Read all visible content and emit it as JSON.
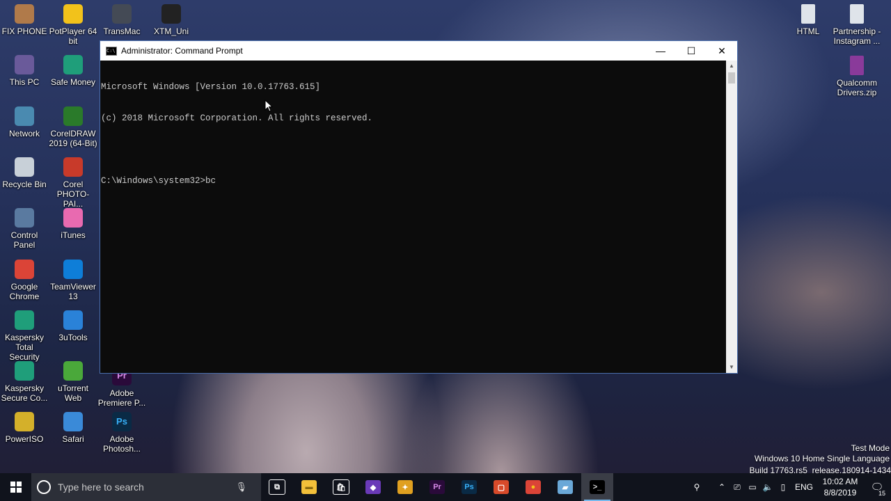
{
  "desktop": {
    "left_column": [
      {
        "label": "FIX PHONE",
        "icon": "phone-icon",
        "color": "#b07a4a"
      },
      {
        "label": "This PC",
        "icon": "computer-icon",
        "color": "#6a5a9a"
      },
      {
        "label": "Network",
        "icon": "network-icon",
        "color": "#4a8ab0"
      },
      {
        "label": "Recycle Bin",
        "icon": "recycle-bin-icon",
        "color": "#c8d0d8"
      },
      {
        "label": "Control Panel",
        "icon": "control-panel-icon",
        "color": "#5a7aa0"
      },
      {
        "label": "Google Chrome",
        "icon": "chrome-icon",
        "color": "#db4437"
      },
      {
        "label": "Kaspersky Total Security",
        "icon": "kaspersky-icon",
        "color": "#1f9e7a"
      },
      {
        "label": "Kaspersky Secure Co...",
        "icon": "kaspersky-secure-icon",
        "color": "#1f9e7a"
      },
      {
        "label": "PowerISO",
        "icon": "poweriso-icon",
        "color": "#d4b02a"
      }
    ],
    "middle_column": [
      {
        "label": "PotPlayer 64 bit",
        "icon": "potplayer-icon",
        "color": "#f2c21b"
      },
      {
        "label": "Safe Money",
        "icon": "safe-money-icon",
        "color": "#1f9e7a"
      },
      {
        "label": "CorelDRAW 2019 (64-Bit)",
        "icon": "coreldraw-icon",
        "color": "#2a7a2a"
      },
      {
        "label": "Corel PHOTO-PAI...",
        "icon": "corel-photopaint-icon",
        "color": "#c83a2a"
      },
      {
        "label": "iTunes",
        "icon": "itunes-icon",
        "color": "#e86ab0"
      },
      {
        "label": "TeamViewer 13",
        "icon": "teamviewer-icon",
        "color": "#0e7ed8"
      },
      {
        "label": "3uTools",
        "icon": "3utools-icon",
        "color": "#2a82d8"
      },
      {
        "label": "uTorrent Web",
        "icon": "utorrent-icon",
        "color": "#4aa83a"
      },
      {
        "label": "Safari",
        "icon": "safari-icon",
        "color": "#3a8ad8"
      }
    ],
    "third_column": [
      {
        "label": "TransMac",
        "icon": "transmac-icon",
        "color": "#444a55"
      },
      {
        "label": "Adobe Premiere P...",
        "icon": "premiere-icon",
        "color": "#2a0a3a"
      },
      {
        "label": "Adobe Photosh...",
        "icon": "photoshop-icon",
        "color": "#0a2a45"
      }
    ],
    "fourth_column": [
      {
        "label": "XTM_Uni",
        "icon": "xtm-icon",
        "color": "#222"
      }
    ],
    "right_column": [
      {
        "label": "HTML",
        "icon": "html-file-icon",
        "color": "#dfe4ea"
      },
      {
        "label": "Partnership - Instagram ...",
        "icon": "document-icon",
        "color": "#dfe4ea"
      },
      {
        "label": "Qualcomm Drivers.zip",
        "icon": "zip-archive-icon",
        "color": "#8a3a9a"
      }
    ]
  },
  "cmd_window": {
    "title": "Administrator: Command Prompt",
    "lines": [
      "Microsoft Windows [Version 10.0.17763.615]",
      "(c) 2018 Microsoft Corporation. All rights reserved.",
      "",
      "C:\\Windows\\system32>bc"
    ],
    "minimize": "—",
    "maximize": "☐",
    "close": "✕"
  },
  "taskbar": {
    "search_placeholder": "Type here to search",
    "apps": [
      {
        "name": "task-view",
        "glyph": "⧉",
        "color": "#10131c",
        "fg": "#fff"
      },
      {
        "name": "file-explorer",
        "glyph": "▬",
        "color": "#f3c03a",
        "fg": "#8a6a10"
      },
      {
        "name": "store",
        "glyph": "🛍",
        "color": "#10131c",
        "fg": "#fff"
      },
      {
        "name": "visual-studio",
        "glyph": "◆",
        "color": "#6a3ab8",
        "fg": "#fff"
      },
      {
        "name": "xampp",
        "glyph": "✦",
        "color": "#e0a020",
        "fg": "#fff"
      },
      {
        "name": "premiere",
        "glyph": "Pr",
        "color": "#2a0a3a",
        "fg": "#d88ae8"
      },
      {
        "name": "photoshop",
        "glyph": "Ps",
        "color": "#0a2a45",
        "fg": "#38b0f8"
      },
      {
        "name": "app-red",
        "glyph": "▢",
        "color": "#d84a2a",
        "fg": "#fff"
      },
      {
        "name": "chrome",
        "glyph": "●",
        "color": "#db4437",
        "fg": "#f2c21b"
      },
      {
        "name": "app-glass",
        "glyph": "▰",
        "color": "#6aa8d8",
        "fg": "#fff"
      },
      {
        "name": "cmd",
        "glyph": ">_",
        "color": "#000",
        "fg": "#ddd"
      }
    ],
    "language": "ENG",
    "time": "10:02 AM",
    "date": "8/8/2019",
    "notification_count": "15"
  },
  "watermark": {
    "line1": "Test Mode",
    "line2": "Windows 10 Home Single Language",
    "line3": "Build 17763.rs5_release.180914-1434"
  }
}
